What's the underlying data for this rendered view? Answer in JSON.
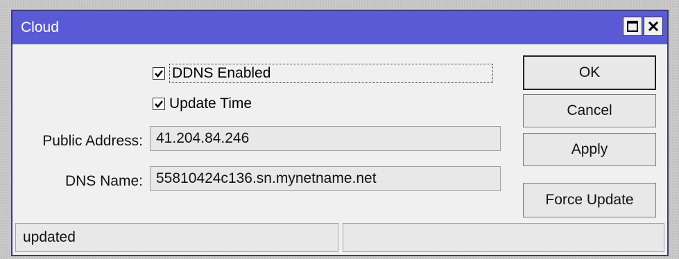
{
  "window": {
    "title": "Cloud"
  },
  "form": {
    "ddns_enabled": {
      "label": "DDNS Enabled",
      "checked": true
    },
    "update_time": {
      "label": "Update Time",
      "checked": true
    },
    "public_address": {
      "label": "Public Address:",
      "value": "41.204.84.246"
    },
    "dns_name": {
      "label": "DNS Name:",
      "value": "55810424c136.sn.mynetname.net"
    }
  },
  "buttons": {
    "ok": "OK",
    "cancel": "Cancel",
    "apply": "Apply",
    "force_update": "Force Update"
  },
  "status": {
    "left": "updated",
    "right": ""
  },
  "icons": {
    "maximize": "maximize-icon",
    "close": "close-icon",
    "checkmark": "check-icon"
  },
  "colors": {
    "titlebar": "#5a5ad6",
    "window_bg": "#f0f0f0"
  }
}
